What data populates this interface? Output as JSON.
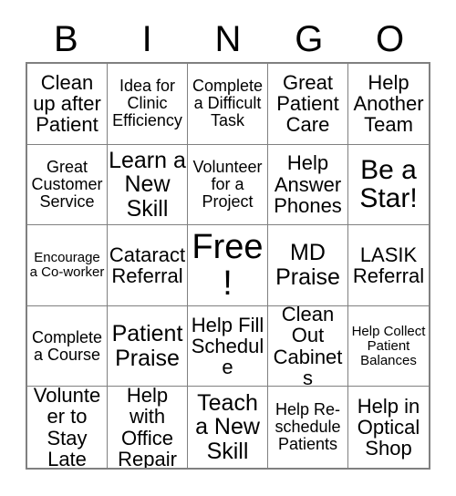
{
  "card": {
    "title": "BINGO",
    "header_letters": [
      "B",
      "I",
      "N",
      "G",
      "O"
    ],
    "grid_size": "5x5",
    "colors": {
      "background": "#ffffff",
      "text": "#000000",
      "grid_line": "#808080"
    },
    "free_space": "Free!",
    "rows": [
      [
        {
          "text": "Clean up after Patient",
          "size": "md"
        },
        {
          "text": "Idea for Clinic Efficiency",
          "size": "sm"
        },
        {
          "text": "Complete a Difficult Task",
          "size": "sm"
        },
        {
          "text": "Great Patient Care",
          "size": "md"
        },
        {
          "text": "Help Another Team",
          "size": "md"
        }
      ],
      [
        {
          "text": "Great Customer Service",
          "size": "sm"
        },
        {
          "text": "Learn a New Skill",
          "size": "lg"
        },
        {
          "text": "Volunteer for a Project",
          "size": "sm"
        },
        {
          "text": "Help Answer Phones",
          "size": "md"
        },
        {
          "text": "Be a Star!",
          "size": "xl"
        }
      ],
      [
        {
          "text": "Encourage a Co-worker",
          "size": "xs"
        },
        {
          "text": "Cataract Referral",
          "size": "md"
        },
        {
          "text": "Free!",
          "size": "xxl"
        },
        {
          "text": "MD Praise",
          "size": "lg"
        },
        {
          "text": "LASIK Referral",
          "size": "md"
        }
      ],
      [
        {
          "text": "Complete a Course",
          "size": "sm"
        },
        {
          "text": "Patient Praise",
          "size": "lg"
        },
        {
          "text": "Help Fill Schedule",
          "size": "md"
        },
        {
          "text": "Clean Out Cabinets",
          "size": "md"
        },
        {
          "text": "Help Collect Patient Balances",
          "size": "xs"
        }
      ],
      [
        {
          "text": "Volunteer to Stay Late",
          "size": "md"
        },
        {
          "text": "Help with Office Repair",
          "size": "md"
        },
        {
          "text": "Teach a New Skill",
          "size": "lg"
        },
        {
          "text": "Help Re-schedule Patients",
          "size": "sm"
        },
        {
          "text": "Help in Optical Shop",
          "size": "md"
        }
      ]
    ]
  }
}
